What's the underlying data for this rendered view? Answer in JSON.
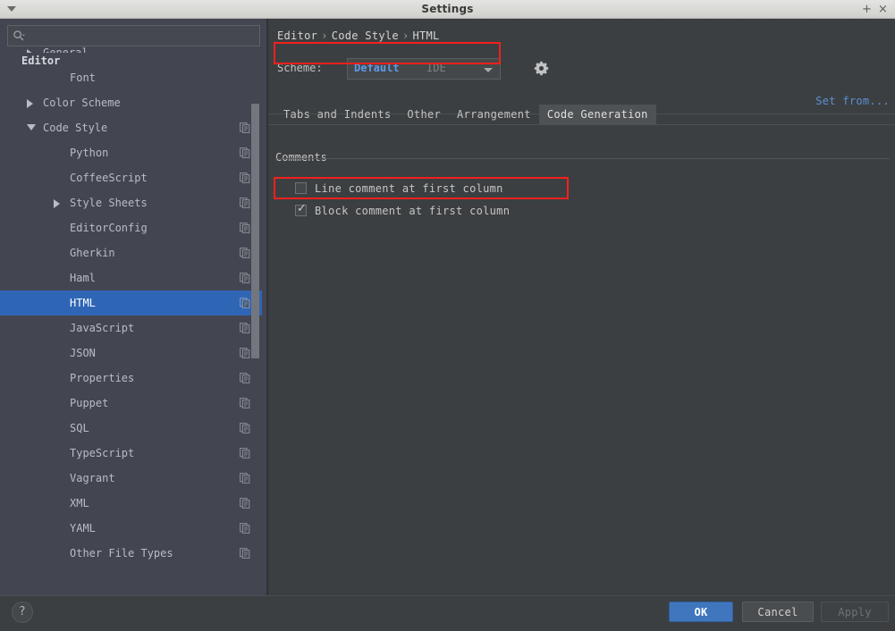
{
  "window": {
    "title": "Settings",
    "menu_icon": "chevron-down-icon",
    "maximize_label": "+",
    "close_label": "×"
  },
  "search": {
    "value": "",
    "placeholder": "",
    "icon": "search-icon"
  },
  "sidebar": {
    "sticky_header": "Editor",
    "items": [
      {
        "label": "General",
        "indent": 1,
        "twisty": "right",
        "sheet": false,
        "selected": false
      },
      {
        "label": "Font",
        "indent": 2,
        "twisty": "none",
        "sheet": false,
        "selected": false
      },
      {
        "label": "Color Scheme",
        "indent": 1,
        "twisty": "right",
        "sheet": false,
        "selected": false
      },
      {
        "label": "Code Style",
        "indent": 1,
        "twisty": "down",
        "sheet": true,
        "selected": false
      },
      {
        "label": "Python",
        "indent": 2,
        "twisty": "none",
        "sheet": true,
        "selected": false
      },
      {
        "label": "CoffeeScript",
        "indent": 2,
        "twisty": "none",
        "sheet": true,
        "selected": false
      },
      {
        "label": "Style Sheets",
        "indent": 2,
        "twisty": "right",
        "sheet": true,
        "selected": false
      },
      {
        "label": "EditorConfig",
        "indent": 2,
        "twisty": "none",
        "sheet": true,
        "selected": false
      },
      {
        "label": "Gherkin",
        "indent": 2,
        "twisty": "none",
        "sheet": true,
        "selected": false
      },
      {
        "label": "Haml",
        "indent": 2,
        "twisty": "none",
        "sheet": true,
        "selected": false
      },
      {
        "label": "HTML",
        "indent": 2,
        "twisty": "none",
        "sheet": true,
        "selected": true
      },
      {
        "label": "JavaScript",
        "indent": 2,
        "twisty": "none",
        "sheet": true,
        "selected": false
      },
      {
        "label": "JSON",
        "indent": 2,
        "twisty": "none",
        "sheet": true,
        "selected": false
      },
      {
        "label": "Properties",
        "indent": 2,
        "twisty": "none",
        "sheet": true,
        "selected": false
      },
      {
        "label": "Puppet",
        "indent": 2,
        "twisty": "none",
        "sheet": true,
        "selected": false
      },
      {
        "label": "SQL",
        "indent": 2,
        "twisty": "none",
        "sheet": true,
        "selected": false
      },
      {
        "label": "TypeScript",
        "indent": 2,
        "twisty": "none",
        "sheet": true,
        "selected": false
      },
      {
        "label": "Vagrant",
        "indent": 2,
        "twisty": "none",
        "sheet": true,
        "selected": false
      },
      {
        "label": "XML",
        "indent": 2,
        "twisty": "none",
        "sheet": true,
        "selected": false
      },
      {
        "label": "YAML",
        "indent": 2,
        "twisty": "none",
        "sheet": true,
        "selected": false
      },
      {
        "label": "Other File Types",
        "indent": 2,
        "twisty": "none",
        "sheet": true,
        "selected": false
      }
    ]
  },
  "breadcrumb": {
    "parts": [
      "Editor",
      "Code Style",
      "HTML"
    ],
    "separator": "›"
  },
  "scheme": {
    "label": "Scheme:",
    "value": "Default",
    "scope": "IDE",
    "gear_icon": "gear-icon",
    "set_from_label": "Set from..."
  },
  "tabs": [
    {
      "label": "Tabs and Indents",
      "active": false
    },
    {
      "label": "Other",
      "active": false
    },
    {
      "label": "Arrangement",
      "active": false
    },
    {
      "label": "Code Generation",
      "active": true
    }
  ],
  "comments_group": {
    "title": "Comments",
    "options": [
      {
        "label": "Line comment at first column",
        "checked": false
      },
      {
        "label": "Block comment at first column",
        "checked": true
      }
    ]
  },
  "footer": {
    "help_label": "?",
    "ok_label": "OK",
    "cancel_label": "Cancel",
    "apply_label": "Apply"
  },
  "annotations": [
    {
      "name": "breadcrumb-highlight",
      "color": "#f3201e"
    },
    {
      "name": "line-comment-highlight",
      "color": "#f3201e"
    }
  ],
  "colors": {
    "selection_blue": "#2f65b5",
    "accent_link": "#5b8fd4",
    "scheme_value": "#5f9ae8",
    "annotation_red": "#f3201e",
    "sidebar_bg": "#434650",
    "content_bg": "#3c3f41"
  }
}
